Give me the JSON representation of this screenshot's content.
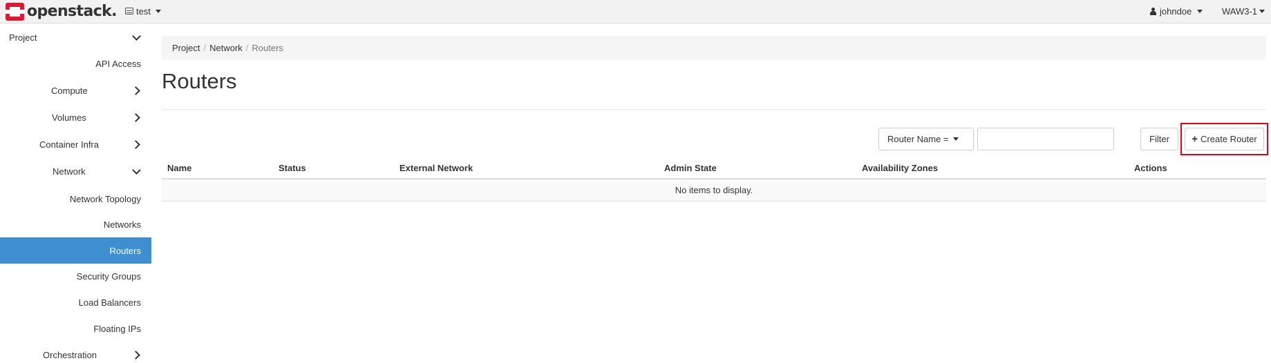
{
  "topbar": {
    "brand": "openstack.",
    "project": "test",
    "user": "johndoe",
    "region": "WAW3-1"
  },
  "sidebar": {
    "items": [
      {
        "label": "Project"
      },
      {
        "label": "API Access"
      },
      {
        "label": "Compute"
      },
      {
        "label": "Volumes"
      },
      {
        "label": "Container Infra"
      },
      {
        "label": "Network"
      },
      {
        "label": "Network Topology"
      },
      {
        "label": "Networks"
      },
      {
        "label": "Routers"
      },
      {
        "label": "Security Groups"
      },
      {
        "label": "Load Balancers"
      },
      {
        "label": "Floating IPs"
      },
      {
        "label": "Orchestration"
      }
    ]
  },
  "breadcrumb": [
    "Project",
    "Network",
    "Routers"
  ],
  "page_title": "Routers",
  "filter": {
    "select_label": "Router Name =",
    "input_value": "",
    "filter_button": "Filter",
    "create_button": "Create Router"
  },
  "table": {
    "columns": [
      "Name",
      "Status",
      "External Network",
      "Admin State",
      "Availability Zones",
      "Actions"
    ],
    "empty_message": "No items to display."
  },
  "colors": {
    "active_sidebar": "#3e8ed0",
    "highlight": "#e3001b",
    "brand_red": "#da1a32"
  }
}
